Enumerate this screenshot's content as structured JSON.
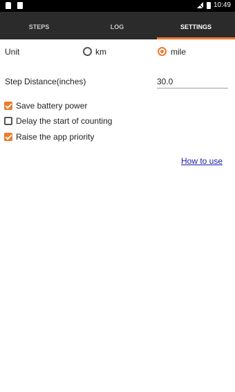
{
  "status_bar": {
    "time": "10:49",
    "left_icons": [
      "notification-icon",
      "sd-card-icon"
    ],
    "right_icons": [
      "no-signal-icon",
      "battery-icon"
    ]
  },
  "tabs": [
    {
      "label": "STEPS"
    },
    {
      "label": "LOG"
    },
    {
      "label": "SETTINGS",
      "selected": true
    }
  ],
  "accent_color": "#f07a2c",
  "settings": {
    "unit_label": "Unit",
    "unit_options": [
      {
        "label": "km",
        "selected": false
      },
      {
        "label": "mile",
        "selected": true
      }
    ],
    "step_distance_label": "Step Distance(inches)",
    "step_distance_value": "30.0",
    "checkboxes": [
      {
        "label": "Save battery power",
        "checked": true
      },
      {
        "label": "Delay the start of counting",
        "checked": false
      },
      {
        "label": "Raise the app priority",
        "checked": true
      }
    ],
    "how_to_use": "How to use"
  }
}
